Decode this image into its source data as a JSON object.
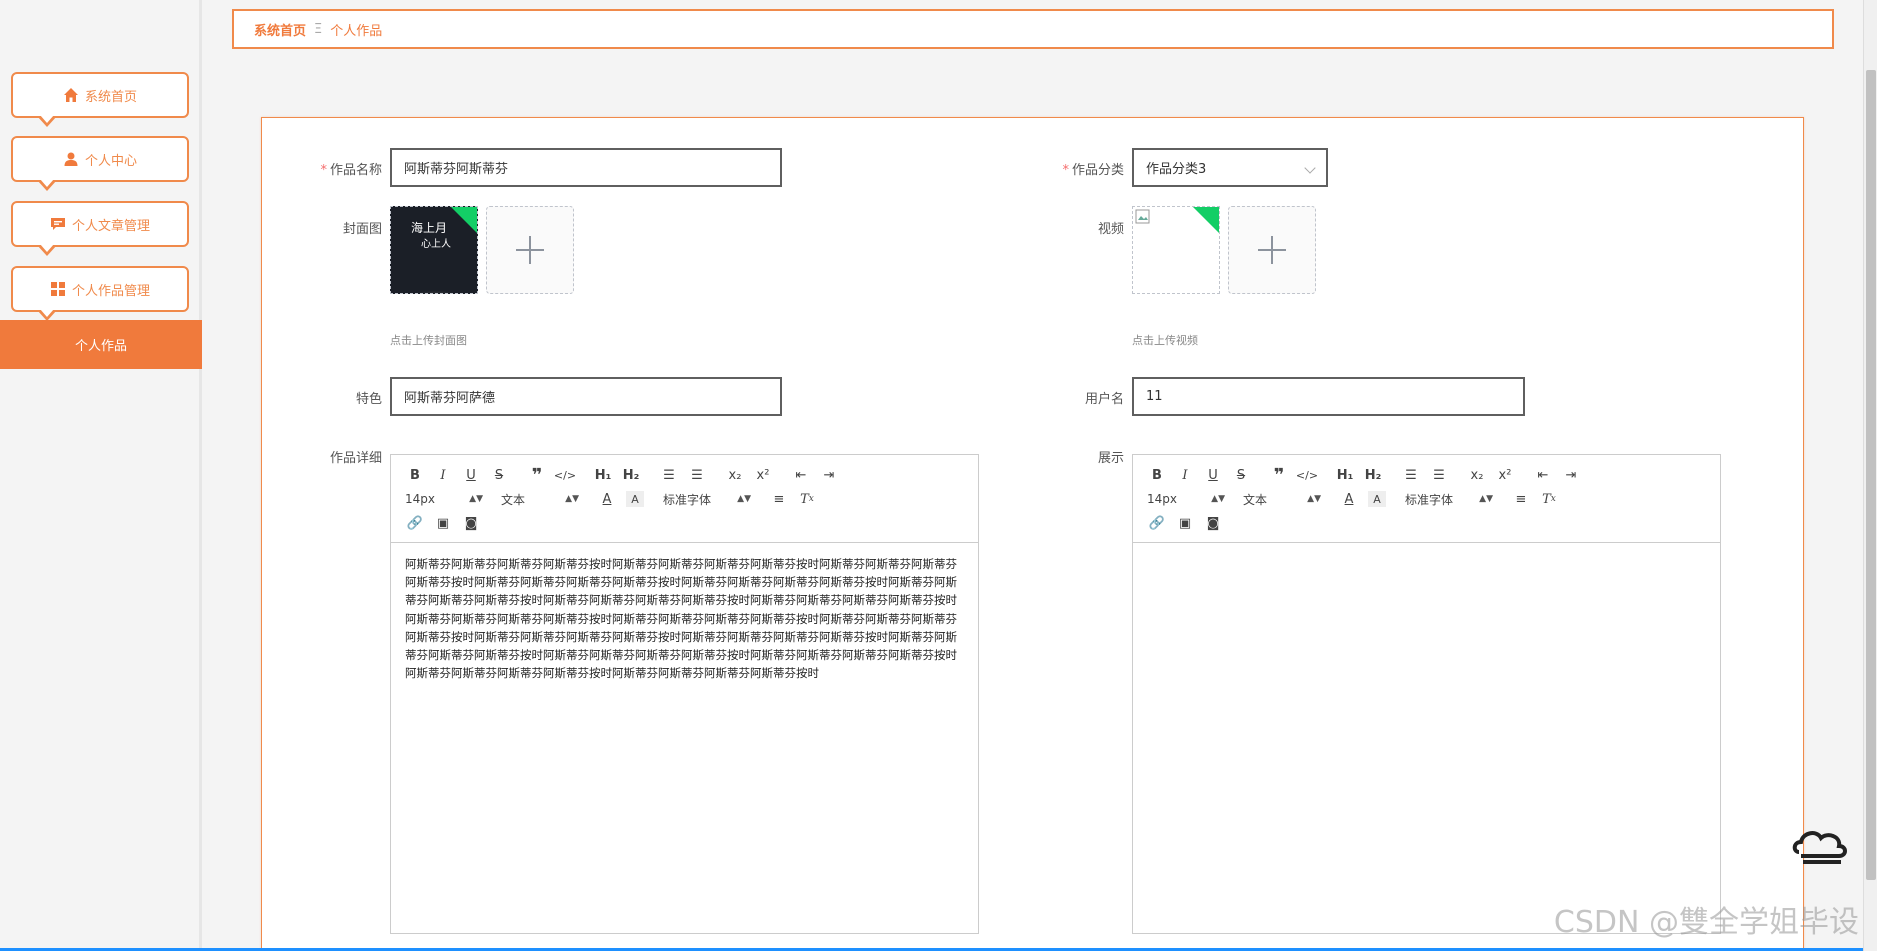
{
  "sidebar": {
    "items": [
      {
        "label": "系统首页",
        "icon": "home-icon"
      },
      {
        "label": "个人中心",
        "icon": "user-icon"
      },
      {
        "label": "个人文章管理",
        "icon": "chat-icon"
      },
      {
        "label": "个人作品管理",
        "icon": "grid-icon"
      }
    ],
    "active": "个人作品"
  },
  "breadcrumb": {
    "home": "系统首页",
    "separator": "Ξ",
    "current": "个人作品"
  },
  "form": {
    "name": {
      "label": "作品名称",
      "value": "阿斯蒂芬阿斯蒂芬"
    },
    "category": {
      "label": "作品分类",
      "value": "作品分类3"
    },
    "cover": {
      "label": "封面图",
      "tip": "点击上传封面图",
      "thumb_title": "海上月",
      "thumb_subtitle": "心上人"
    },
    "video": {
      "label": "视频",
      "tip": "点击上传视频"
    },
    "feature": {
      "label": "特色",
      "value": "阿斯蒂芬阿萨德"
    },
    "username": {
      "label": "用户名",
      "value": "11"
    },
    "detail": {
      "label": "作品详细",
      "content": "阿斯蒂芬阿斯蒂芬阿斯蒂芬阿斯蒂芬按时阿斯蒂芬阿斯蒂芬阿斯蒂芬阿斯蒂芬按时阿斯蒂芬阿斯蒂芬阿斯蒂芬阿斯蒂芬按时阿斯蒂芬阿斯蒂芬阿斯蒂芬阿斯蒂芬按时阿斯蒂芬阿斯蒂芬阿斯蒂芬阿斯蒂芬按时阿斯蒂芬阿斯蒂芬阿斯蒂芬阿斯蒂芬按时阿斯蒂芬阿斯蒂芬阿斯蒂芬阿斯蒂芬按时阿斯蒂芬阿斯蒂芬阿斯蒂芬阿斯蒂芬按时阿斯蒂芬阿斯蒂芬阿斯蒂芬阿斯蒂芬按时阿斯蒂芬阿斯蒂芬阿斯蒂芬阿斯蒂芬按时阿斯蒂芬阿斯蒂芬阿斯蒂芬阿斯蒂芬按时阿斯蒂芬阿斯蒂芬阿斯蒂芬阿斯蒂芬按时阿斯蒂芬阿斯蒂芬阿斯蒂芬阿斯蒂芬按时阿斯蒂芬阿斯蒂芬阿斯蒂芬阿斯蒂芬按时阿斯蒂芬阿斯蒂芬阿斯蒂芬阿斯蒂芬按时阿斯蒂芬阿斯蒂芬阿斯蒂芬阿斯蒂芬按时阿斯蒂芬阿斯蒂芬阿斯蒂芬阿斯蒂芬按时阿斯蒂芬阿斯蒂芬阿斯蒂芬阿斯蒂芬按时"
    },
    "display": {
      "label": "展示"
    }
  },
  "editor_toolbar": {
    "size": "14px",
    "header": "文本",
    "font": "标准字体"
  },
  "watermark": "CSDN @雙全学姐毕设",
  "colors": {
    "accent": "#f07a3c",
    "border": "#f08a4b",
    "success": "#13ce66"
  }
}
